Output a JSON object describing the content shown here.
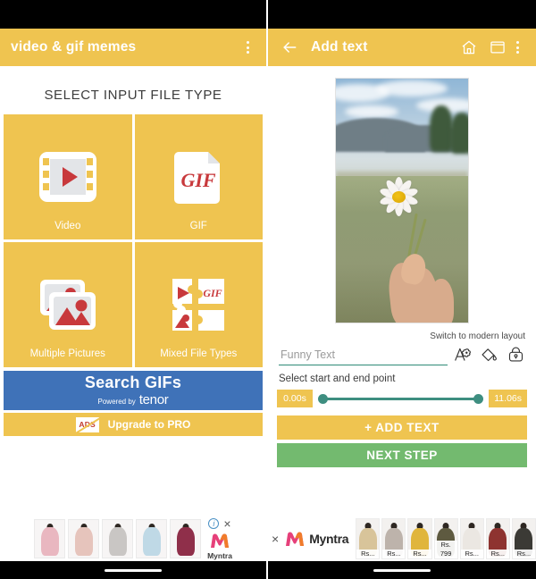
{
  "left_screen": {
    "appbar": {
      "title": "video & gif memes",
      "overflow_icon": "more-vertical-icon"
    },
    "section_title": "SELECT INPUT FILE TYPE",
    "tiles": [
      {
        "label": "Video",
        "icon": "film-strip-play-icon"
      },
      {
        "label": "GIF",
        "icon": "gif-file-icon",
        "glyph": "GIF"
      },
      {
        "label": "Multiple Pictures",
        "icon": "stacked-photos-icon"
      },
      {
        "label": "Mixed File Types",
        "icon": "puzzle-mixed-icon",
        "glyph": "GIF"
      }
    ],
    "search_button": {
      "title": "Search GIFs",
      "powered_by": "Powered by",
      "provider": "tenor",
      "color": "#3F72B8"
    },
    "upgrade_button": {
      "badge": "ADS",
      "label": "Upgrade to PRO"
    },
    "ad": {
      "brand": "Myntra",
      "info_glyph": "i",
      "close_glyph": "×",
      "thumb_colors": [
        "#e9b7c0",
        "#e6c4bc",
        "#c9c6c4",
        "#bfd9e6",
        "#8f2f4a"
      ]
    }
  },
  "right_screen": {
    "appbar": {
      "back_icon": "arrow-left-icon",
      "title": "Add text",
      "home_icon": "home-icon",
      "window_icon": "window-icon",
      "overflow_icon": "more-vertical-icon"
    },
    "preview": {
      "description": "hand holding white daisy flower in grassy field"
    },
    "switch_layout_label": "Switch to modern layout",
    "text_input": {
      "placeholder": "Funny Text",
      "value": ""
    },
    "tool_icons": [
      {
        "name": "text-style-icon"
      },
      {
        "name": "paint-bucket-icon"
      },
      {
        "name": "lock-icon"
      }
    ],
    "range_label": "Select start and end point",
    "range": {
      "start": "0.00s",
      "end": "11.06s",
      "track_color": "#3E8E80"
    },
    "buttons": [
      {
        "label": "+ ADD TEXT",
        "color": "#EFC450"
      },
      {
        "label": "NEXT STEP",
        "color": "#73BA6F"
      }
    ],
    "ad": {
      "brand": "Myntra",
      "close_glyph": "×",
      "products": [
        {
          "price": "Rs..."
        },
        {
          "price": "Rs..."
        },
        {
          "price": "Rs..."
        },
        {
          "price": "Rs. 799"
        },
        {
          "price": "Rs..."
        },
        {
          "price": "Rs..."
        },
        {
          "price": "Rs..."
        }
      ]
    }
  },
  "theme": {
    "accent_yellow": "#EFC450",
    "blue": "#3F72B8",
    "green": "#73BA6F",
    "teal": "#3E8E80",
    "red": "#C0392B"
  }
}
